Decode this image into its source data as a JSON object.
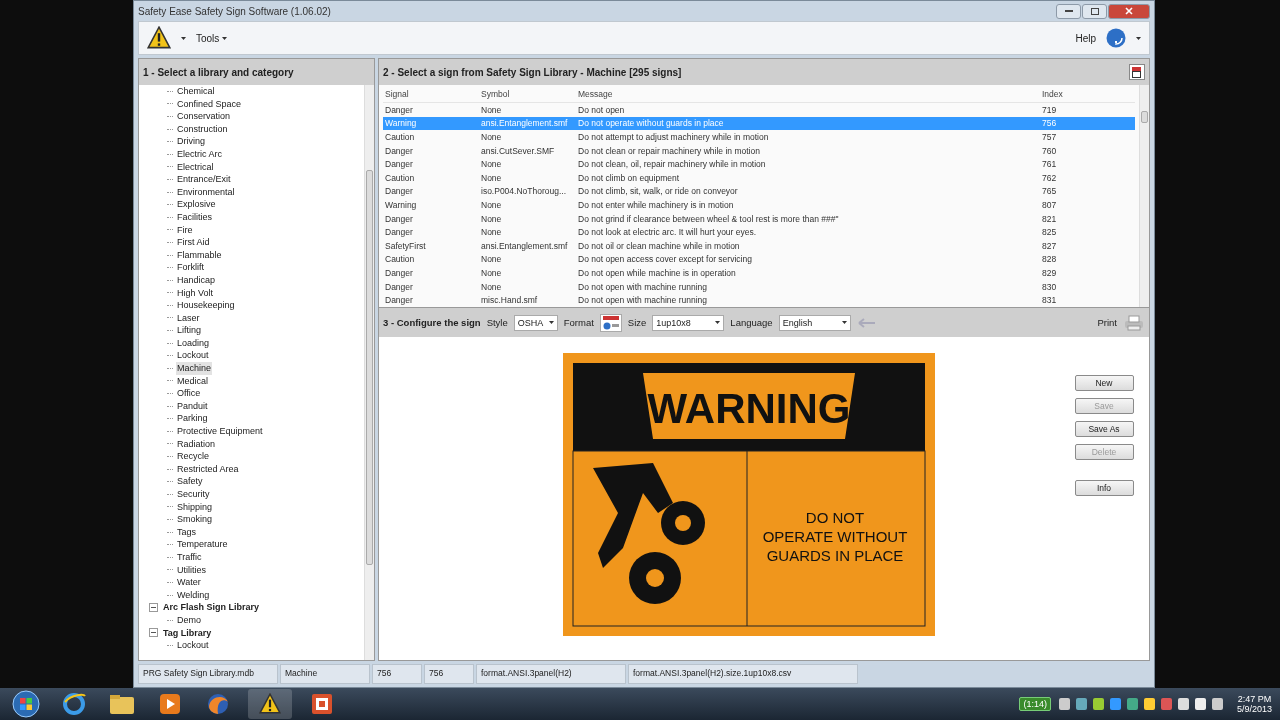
{
  "window": {
    "title": "Safety Ease Safety Sign Software (1.06.02)"
  },
  "toolbar": {
    "menus": [
      {
        "label": "Tools"
      }
    ],
    "help": "Help"
  },
  "library_panel": {
    "title": "1 - Select a library and category",
    "tree": [
      {
        "children": [
          {
            "label": "Chemical",
            "selected": false
          },
          {
            "label": "Confined Space",
            "selected": false
          },
          {
            "label": "Conservation",
            "selected": false
          },
          {
            "label": "Construction",
            "selected": false
          },
          {
            "label": "Driving",
            "selected": false
          },
          {
            "label": "Electric Arc",
            "selected": false
          },
          {
            "label": "Electrical",
            "selected": false
          },
          {
            "label": "Entrance/Exit",
            "selected": false
          },
          {
            "label": "Environmental",
            "selected": false
          },
          {
            "label": "Explosive",
            "selected": false
          },
          {
            "label": "Facilities",
            "selected": false
          },
          {
            "label": "Fire",
            "selected": false
          },
          {
            "label": "First Aid",
            "selected": false
          },
          {
            "label": "Flammable",
            "selected": false
          },
          {
            "label": "Forklift",
            "selected": false
          },
          {
            "label": "Handicap",
            "selected": false
          },
          {
            "label": "High Volt",
            "selected": false
          },
          {
            "label": "Housekeeping",
            "selected": false
          },
          {
            "label": "Laser",
            "selected": false
          },
          {
            "label": "Lifting",
            "selected": false
          },
          {
            "label": "Loading",
            "selected": false
          },
          {
            "label": "Lockout",
            "selected": false
          },
          {
            "label": "Machine",
            "selected": true
          },
          {
            "label": "Medical",
            "selected": false
          },
          {
            "label": "Office",
            "selected": false
          },
          {
            "label": "Panduit",
            "selected": false
          },
          {
            "label": "Parking",
            "selected": false
          },
          {
            "label": "Protective Equipment",
            "selected": false
          },
          {
            "label": "Radiation",
            "selected": false
          },
          {
            "label": "Recycle",
            "selected": false
          },
          {
            "label": "Restricted Area",
            "selected": false
          },
          {
            "label": "Safety",
            "selected": false
          },
          {
            "label": "Security",
            "selected": false
          },
          {
            "label": "Shipping",
            "selected": false
          },
          {
            "label": "Smoking",
            "selected": false
          },
          {
            "label": "Tags",
            "selected": false
          },
          {
            "label": "Temperature",
            "selected": false
          },
          {
            "label": "Traffic",
            "selected": false
          },
          {
            "label": "Utilities",
            "selected": false
          },
          {
            "label": "Water",
            "selected": false
          },
          {
            "label": "Welding",
            "selected": false
          }
        ]
      },
      {
        "label": "Arc Flash Sign Library",
        "expanded": true,
        "children": [
          {
            "label": "Demo",
            "selected": false
          }
        ]
      },
      {
        "label": "Tag Library",
        "expanded": true,
        "children": [
          {
            "label": "Lockout",
            "selected": false
          }
        ]
      }
    ]
  },
  "sign_panel": {
    "title": "2 - Select a sign from Safety Sign Library - Machine [295 signs]",
    "table": {
      "columns": [
        "Signal",
        "Symbol",
        "Message",
        "Index"
      ],
      "rows": [
        {
          "cells": [
            "Danger",
            "None",
            "Do not open",
            "719"
          ],
          "selected": false
        },
        {
          "cells": [
            "Warning",
            "ansi.Entanglement.smf",
            "Do not operate without guards in place",
            "756"
          ],
          "selected": true
        },
        {
          "cells": [
            "Caution",
            "None",
            "Do not attempt to adjust machinery while in motion",
            "757"
          ],
          "selected": false
        },
        {
          "cells": [
            "Danger",
            "ansi.CutSever.SMF",
            "Do not clean or repair machinery while in motion",
            "760"
          ],
          "selected": false
        },
        {
          "cells": [
            "Danger",
            "None",
            "Do not clean, oil, repair machinery while in motion",
            "761"
          ],
          "selected": false
        },
        {
          "cells": [
            "Caution",
            "None",
            "Do not climb on equipment",
            "762"
          ],
          "selected": false
        },
        {
          "cells": [
            "Danger",
            "iso.P004.NoThoroug...",
            "Do not climb, sit, walk, or ride on conveyor",
            "765"
          ],
          "selected": false
        },
        {
          "cells": [
            "Warning",
            "None",
            "Do not enter while machinery is in motion",
            "807"
          ],
          "selected": false
        },
        {
          "cells": [
            "Danger",
            "None",
            "Do not grind if clearance between wheel & tool rest  is more than ###\"",
            "821"
          ],
          "selected": false
        },
        {
          "cells": [
            "Danger",
            "None",
            "Do not look at electric arc. It will hurt your eyes.",
            "825"
          ],
          "selected": false
        },
        {
          "cells": [
            "SafetyFirst",
            "ansi.Entanglement.smf",
            "Do not oil or clean machine while in motion",
            "827"
          ],
          "selected": false
        },
        {
          "cells": [
            "Caution",
            "None",
            "Do not open access cover except for servicing",
            "828"
          ],
          "selected": false
        },
        {
          "cells": [
            "Danger",
            "None",
            "Do not open while machine is in operation",
            "829"
          ],
          "selected": false
        },
        {
          "cells": [
            "Danger",
            "None",
            "Do not open with machine running",
            "830"
          ],
          "selected": false
        },
        {
          "cells": [
            "Danger",
            "misc.Hand.smf",
            "Do not open with machine  running",
            "831"
          ],
          "selected": false
        }
      ]
    }
  },
  "configure_panel": {
    "title": "3 - Configure the sign",
    "style": {
      "label": "Style",
      "value": "OSHA"
    },
    "format": {
      "label": "Format"
    },
    "size": {
      "label": "Size",
      "value": "1up10x8"
    },
    "language": {
      "label": "Language",
      "value": "English"
    },
    "print": "Print",
    "sign": {
      "header": "WARNING",
      "message": "DO NOT OPERATE WITHOUT GUARDS IN PLACE"
    },
    "buttons": [
      {
        "label": "New",
        "disabled": false
      },
      {
        "label": "Save",
        "disabled": true
      },
      {
        "label": "Save As",
        "disabled": false
      },
      {
        "label": "Delete",
        "disabled": true
      },
      {
        "label": "Info",
        "disabled": false
      }
    ]
  },
  "status_bar": [
    "PRG Safety Sign Library.mdb",
    "Machine",
    "756",
    "756",
    "format.ANSI.3panel(H2)",
    "format.ANSI.3panel(H2).size.1up10x8.csv"
  ],
  "taskbar": {
    "timer": "(1:14)",
    "time": "2:47 PM",
    "date": "5/9/2013"
  }
}
